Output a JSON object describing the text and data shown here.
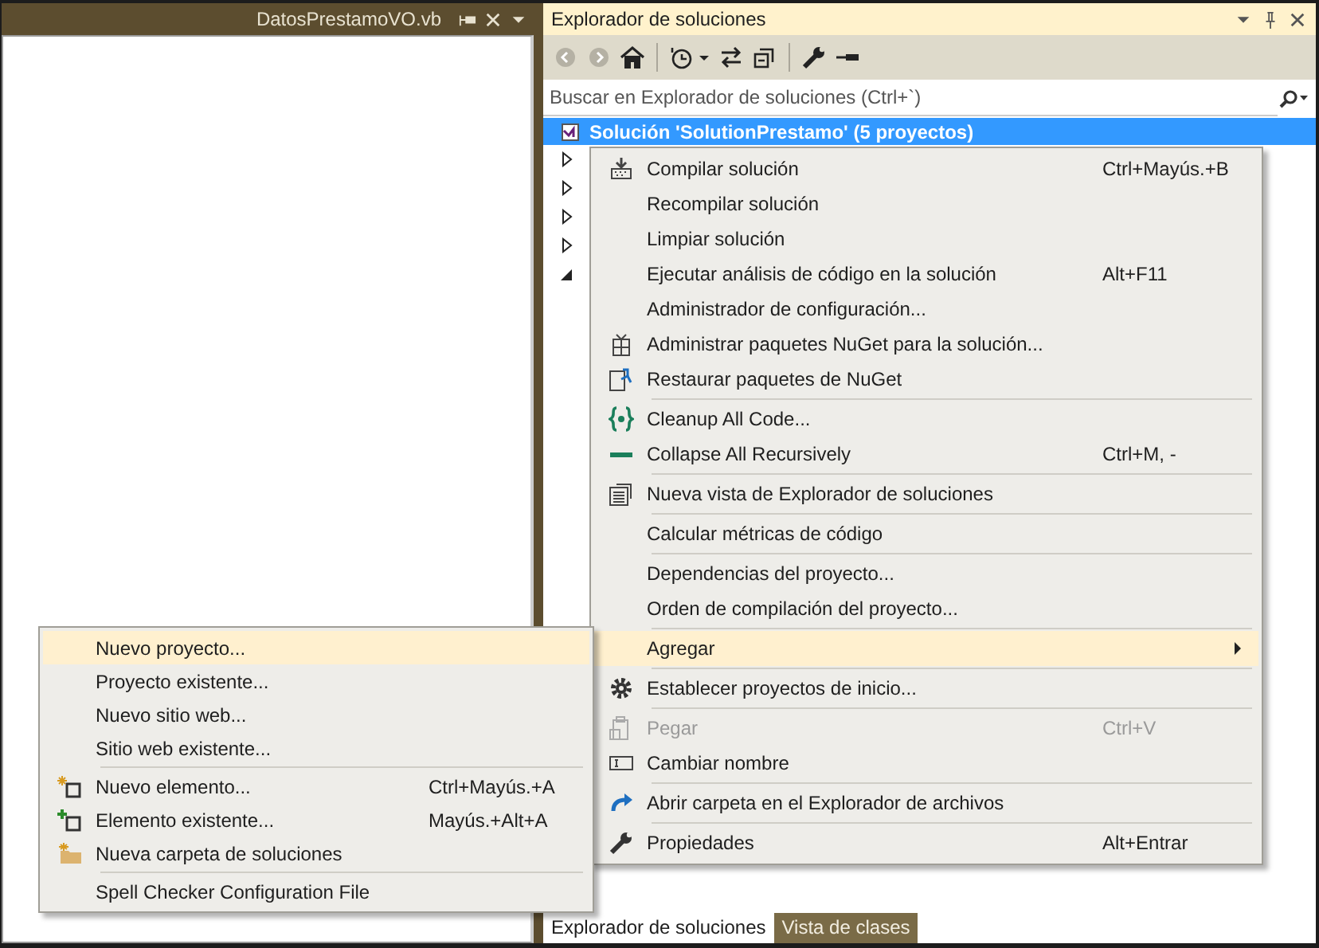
{
  "editor_tab": {
    "title": "DatosPrestamoVO.vb"
  },
  "explorer": {
    "title": "Explorador de soluciones",
    "search": {
      "placeholder": "Buscar en Explorador de soluciones (Ctrl+`)"
    },
    "tree": {
      "label": "Solución 'SolutionPrestamo'  (5 proyectos)",
      "selected": true,
      "children": [
        {
          "expanded": false
        },
        {
          "expanded": false
        },
        {
          "expanded": false
        },
        {
          "expanded": false
        },
        {
          "expanded": true
        }
      ]
    },
    "bottom_tabs": [
      {
        "label": "Explorador de soluciones",
        "selected": true
      },
      {
        "label": "Vista de clases",
        "selected": false
      }
    ]
  },
  "context_menu": {
    "groups": [
      [
        {
          "label": "Compilar solución",
          "shortcut": "Ctrl+Mayús.+B"
        },
        {
          "label": "Recompilar solución"
        },
        {
          "label": "Limpiar solución"
        },
        {
          "label": "Ejecutar análisis de código en la solución",
          "shortcut": "Alt+F11"
        },
        {
          "label": "Administrador de configuración..."
        },
        {
          "label": "Administrar paquetes NuGet para la solución..."
        },
        {
          "label": "Restaurar paquetes de NuGet"
        }
      ],
      [
        {
          "label": "Cleanup All Code..."
        },
        {
          "label": "Collapse All Recursively",
          "shortcut": "Ctrl+M, -"
        }
      ],
      [
        {
          "label": "Nueva vista de Explorador de soluciones"
        }
      ],
      [
        {
          "label": "Calcular métricas de código"
        }
      ],
      [
        {
          "label": "Dependencias del proyecto..."
        },
        {
          "label": "Orden de compilación del proyecto..."
        }
      ],
      [
        {
          "label": "Agregar",
          "highlighted": true,
          "submenu": true
        }
      ],
      [
        {
          "label": "Establecer proyectos de inicio..."
        }
      ],
      [
        {
          "label": "Pegar",
          "shortcut": "Ctrl+V",
          "disabled": true
        },
        {
          "label": "Cambiar nombre"
        }
      ],
      [
        {
          "label": "Abrir carpeta en el Explorador de archivos"
        }
      ],
      [
        {
          "label": "Propiedades",
          "shortcut": "Alt+Entrar"
        }
      ]
    ]
  },
  "submenu": {
    "groups": [
      [
        {
          "label": "Nuevo proyecto...",
          "highlighted": true
        },
        {
          "label": "Proyecto existente...",
          "highlighted": false
        },
        {
          "label": "Nuevo sitio web...",
          "highlighted": false
        },
        {
          "label": "Sitio web existente...",
          "highlighted": false
        }
      ],
      [
        {
          "label": "Nuevo elemento...",
          "shortcut": "Ctrl+Mayús.+A",
          "highlighted": false
        },
        {
          "label": "Elemento existente...",
          "shortcut": "Mayús.+Alt+A",
          "highlighted": false
        },
        {
          "label": "Nueva carpeta de soluciones",
          "highlighted": false
        }
      ],
      [
        {
          "label": "Spell Checker Configuration File",
          "highlighted": false
        }
      ]
    ]
  }
}
